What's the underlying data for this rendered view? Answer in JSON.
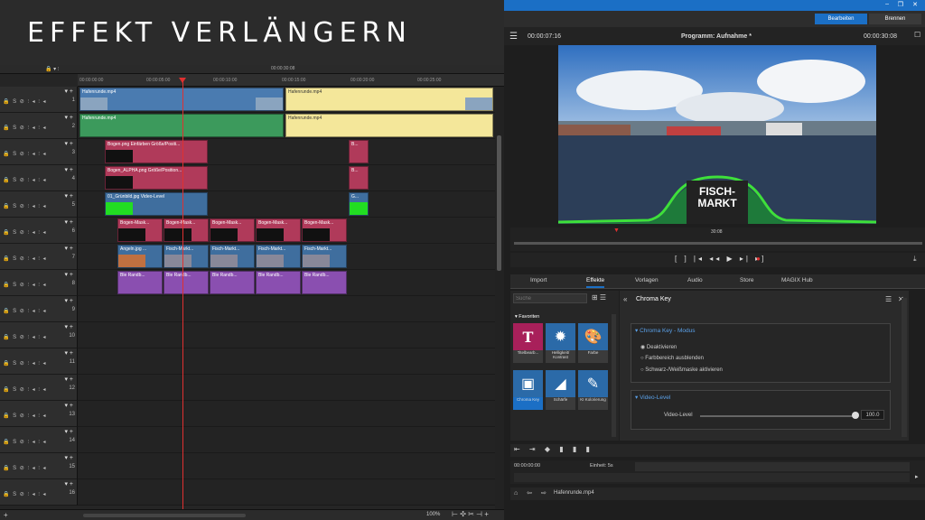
{
  "banner": {
    "title": "EFFEKT VERLÄNGERN"
  },
  "timeline": {
    "ruler_top_time": "00:00:30:08",
    "ruler_ticks": [
      "00:00:00:00",
      "00:00:05:00",
      "00:00:10:00",
      "00:00:15:00",
      "00:00:20:00",
      "00:00:25:00"
    ],
    "tracks": [
      "1",
      "2",
      "3",
      "4",
      "5",
      "6",
      "7",
      "8",
      "9",
      "10",
      "11",
      "12",
      "13",
      "14",
      "15",
      "16"
    ],
    "track_ctl": "🔒 S ⊘ ⫶ ◂ ⫶ ◂",
    "clips": {
      "t1a": "Hafenrunde.mp4",
      "t1b": "Hafenrunde.mp4",
      "t2a": "Hafenrunde.mp4",
      "t2b": "Hafenrunde.mp4",
      "t3a": "Bogen.png  Einfärben  Größe/Positi...",
      "t3b": "B...",
      "t4a": "Bogen_ALPHA.png  Größe/Position...",
      "t4b": "B...",
      "t5a": "01_Grünbild.jpg  Video-Level",
      "t5b": "G...",
      "t6": [
        "Bogen-Mask...",
        "Bogen-Mask...",
        "Bogen-Mask...",
        "Bogen-Mask...",
        "Bogen-Mask..."
      ],
      "t7": [
        "Angeln.jpg ...",
        "Fisch-Markt...",
        "Fisch-Markt...",
        "Fisch-Markt...",
        "Fisch-Markt..."
      ],
      "t8": [
        "Ble  Randb...",
        "Ble  Randb...",
        "Ble  Randb...",
        "Ble  Randb...",
        "Ble  Randb..."
      ]
    },
    "zoom": "100%"
  },
  "window": {
    "mode_edit": "Bearbeiten",
    "mode_burn": "Brennen"
  },
  "monitor": {
    "time_left": "00:00:07:16",
    "title": "Programm: Aufnahme *",
    "time_right": "00:00:30:08",
    "overlay_line1": "FISCH-",
    "overlay_line2": "MARKT",
    "scrub_time": "30:08"
  },
  "tabs": [
    "Import",
    "Effekte",
    "Vorlagen",
    "Audio",
    "Store",
    "MAGIX Hub"
  ],
  "effects": {
    "search_placeholder": "Suche",
    "favorites_label": "Favoriten",
    "tiles": [
      "Titelbearb...",
      "Helligkeit/ Kontrast",
      "Farbe",
      "Chroma Key",
      "Schärfe",
      "KI Kolorierung"
    ],
    "panel_title": "Chroma Key",
    "section1": "Chroma Key - Modus",
    "options": [
      "Deaktivieren",
      "Farbbereich ausblenden",
      "Schwarz-/Weißmaske aktivieren"
    ],
    "section2": "Video-Level",
    "slider_label": "Video-Level",
    "slider_value": "100.0",
    "slider_level": 1.0
  },
  "bottom": {
    "time": "00:00:00:00",
    "unit": "Einheit: 5s",
    "file": "Hafenrunde.mp4"
  },
  "colors": {
    "accent": "#1b6fc5",
    "playhead": "#e03030",
    "clip_blue": "#4a7bb0",
    "clip_yellow": "#f4e79a",
    "clip_red": "#b03a5a",
    "clip_violet": "#8a4fb0",
    "clip_green": "#3c9a5c"
  }
}
